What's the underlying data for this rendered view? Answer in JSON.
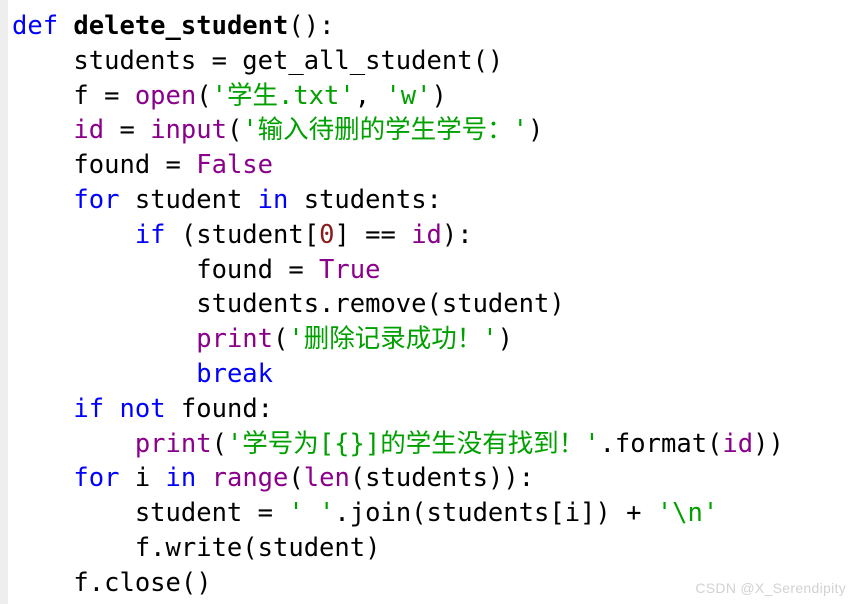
{
  "document": {
    "kind": "python-code-snippet",
    "language": "Python",
    "background_color": "#ffffff",
    "gutter_color": "#eeeeee"
  },
  "colors": {
    "keyword": "#0000ff",
    "builtin": "#8b008b",
    "constant": "#8b008b",
    "string": "#00a000",
    "number": "#8b1a1a",
    "plain": "#000000",
    "watermark": "#d2d2d2"
  },
  "code": {
    "lines": [
      {
        "index": 1,
        "text": "def delete_student():",
        "tokens": [
          {
            "t": "def",
            "c": "kw"
          },
          {
            "t": " ",
            "c": "pl"
          },
          {
            "t": "delete_student",
            "c": "fn"
          },
          {
            "t": "():",
            "c": "pl"
          }
        ]
      },
      {
        "index": 2,
        "text": "    students = get_all_student()",
        "tokens": [
          {
            "t": "    students = get_all_student()",
            "c": "pl"
          }
        ]
      },
      {
        "index": 3,
        "text": "    f = open('学生.txt', 'w')",
        "tokens": [
          {
            "t": "    f = ",
            "c": "pl"
          },
          {
            "t": "open",
            "c": "bi"
          },
          {
            "t": "(",
            "c": "pl"
          },
          {
            "t": "'学生.txt'",
            "c": "str"
          },
          {
            "t": ", ",
            "c": "pl"
          },
          {
            "t": "'w'",
            "c": "str"
          },
          {
            "t": ")",
            "c": "pl"
          }
        ]
      },
      {
        "index": 4,
        "text": "    id = input('输入待删的学生学号：')",
        "tokens": [
          {
            "t": "    ",
            "c": "pl"
          },
          {
            "t": "id",
            "c": "cst"
          },
          {
            "t": " = ",
            "c": "pl"
          },
          {
            "t": "input",
            "c": "bi"
          },
          {
            "t": "(",
            "c": "pl"
          },
          {
            "t": "'输入待删的学生学号：'",
            "c": "str"
          },
          {
            "t": ")",
            "c": "pl"
          }
        ]
      },
      {
        "index": 5,
        "text": "    found = False",
        "tokens": [
          {
            "t": "    found = ",
            "c": "pl"
          },
          {
            "t": "False",
            "c": "cst"
          }
        ]
      },
      {
        "index": 6,
        "text": "    for student in students:",
        "tokens": [
          {
            "t": "    ",
            "c": "pl"
          },
          {
            "t": "for",
            "c": "kw"
          },
          {
            "t": " student ",
            "c": "pl"
          },
          {
            "t": "in",
            "c": "kw"
          },
          {
            "t": " students:",
            "c": "pl"
          }
        ]
      },
      {
        "index": 7,
        "text": "        if (student[0] == id):",
        "tokens": [
          {
            "t": "        ",
            "c": "pl"
          },
          {
            "t": "if",
            "c": "kw"
          },
          {
            "t": " (student[",
            "c": "pl"
          },
          {
            "t": "0",
            "c": "num"
          },
          {
            "t": "] == ",
            "c": "pl"
          },
          {
            "t": "id",
            "c": "cst"
          },
          {
            "t": "):",
            "c": "pl"
          }
        ]
      },
      {
        "index": 8,
        "text": "            found = True",
        "tokens": [
          {
            "t": "            found = ",
            "c": "pl"
          },
          {
            "t": "True",
            "c": "cst"
          }
        ]
      },
      {
        "index": 9,
        "text": "            students.remove(student)",
        "tokens": [
          {
            "t": "            students.remove(student)",
            "c": "pl"
          }
        ]
      },
      {
        "index": 10,
        "text": "            print('删除记录成功！')",
        "tokens": [
          {
            "t": "            ",
            "c": "pl"
          },
          {
            "t": "print",
            "c": "bi"
          },
          {
            "t": "(",
            "c": "pl"
          },
          {
            "t": "'删除记录成功！'",
            "c": "str"
          },
          {
            "t": ")",
            "c": "pl"
          }
        ]
      },
      {
        "index": 11,
        "text": "            break",
        "tokens": [
          {
            "t": "            ",
            "c": "pl"
          },
          {
            "t": "break",
            "c": "kw"
          }
        ]
      },
      {
        "index": 12,
        "text": "    if not found:",
        "tokens": [
          {
            "t": "    ",
            "c": "pl"
          },
          {
            "t": "if",
            "c": "kw"
          },
          {
            "t": " ",
            "c": "pl"
          },
          {
            "t": "not",
            "c": "kw"
          },
          {
            "t": " found:",
            "c": "pl"
          }
        ]
      },
      {
        "index": 13,
        "text": "        print('学号为[{}]的学生没有找到！'.format(id))",
        "tokens": [
          {
            "t": "        ",
            "c": "pl"
          },
          {
            "t": "print",
            "c": "bi"
          },
          {
            "t": "(",
            "c": "pl"
          },
          {
            "t": "'学号为[{}]的学生没有找到！'",
            "c": "str"
          },
          {
            "t": ".format(",
            "c": "pl"
          },
          {
            "t": "id",
            "c": "cst"
          },
          {
            "t": "))",
            "c": "pl"
          }
        ]
      },
      {
        "index": 14,
        "text": "    for i in range(len(students)):",
        "tokens": [
          {
            "t": "    ",
            "c": "pl"
          },
          {
            "t": "for",
            "c": "kw"
          },
          {
            "t": " i ",
            "c": "pl"
          },
          {
            "t": "in",
            "c": "kw"
          },
          {
            "t": " ",
            "c": "pl"
          },
          {
            "t": "range",
            "c": "bi"
          },
          {
            "t": "(",
            "c": "pl"
          },
          {
            "t": "len",
            "c": "bi"
          },
          {
            "t": "(students)):",
            "c": "pl"
          }
        ]
      },
      {
        "index": 15,
        "text": "        student = ' '.join(students[i]) + '\\n'",
        "tokens": [
          {
            "t": "        student = ",
            "c": "pl"
          },
          {
            "t": "' '",
            "c": "str"
          },
          {
            "t": ".join(students[i]) + ",
            "c": "pl"
          },
          {
            "t": "'\\n'",
            "c": "str"
          }
        ]
      },
      {
        "index": 16,
        "text": "        f.write(student)",
        "tokens": [
          {
            "t": "        f.write(student)",
            "c": "pl"
          }
        ]
      },
      {
        "index": 17,
        "text": "    f.close()",
        "tokens": [
          {
            "t": "    f.close()",
            "c": "pl"
          }
        ]
      }
    ]
  },
  "watermark": {
    "text": "CSDN @X_Serendipity"
  }
}
